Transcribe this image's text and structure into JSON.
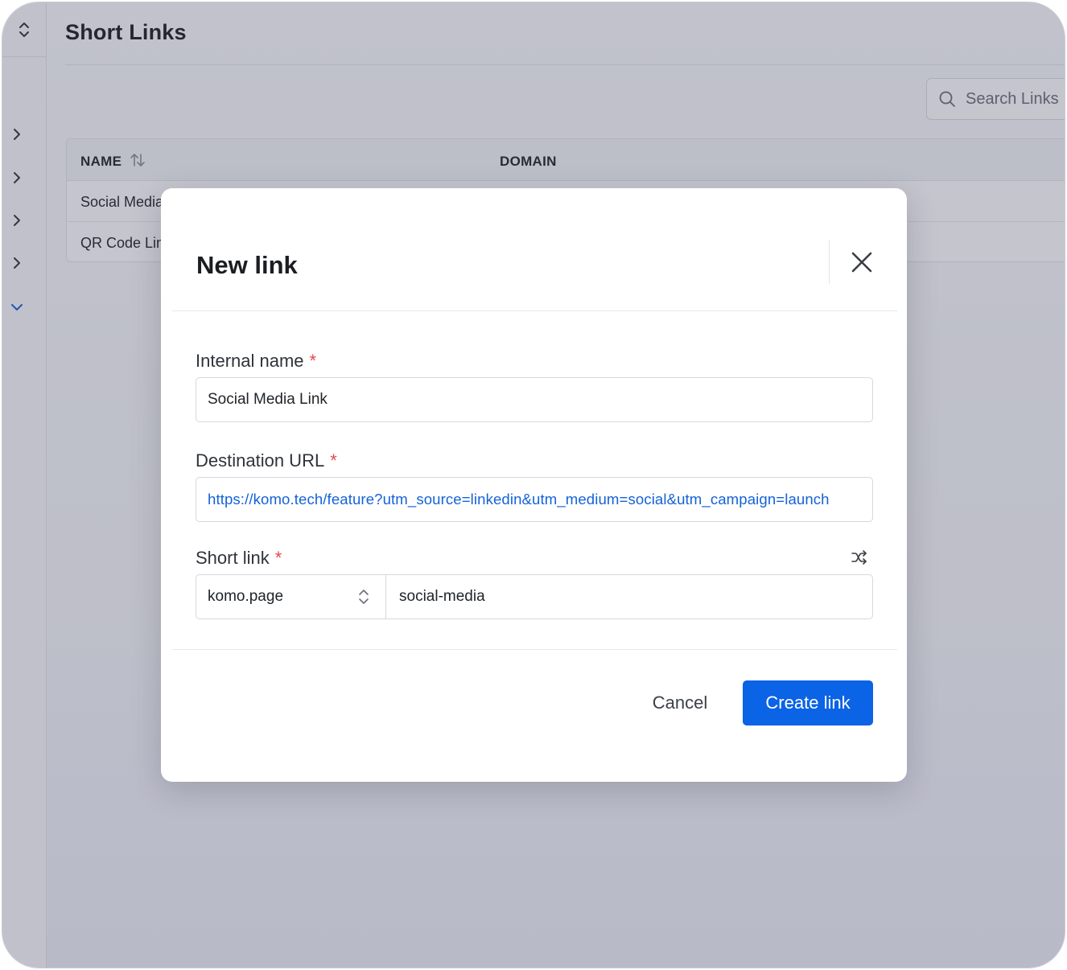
{
  "page": {
    "title": "Short Links"
  },
  "search": {
    "placeholder": "Search Links"
  },
  "table": {
    "columns": [
      "NAME",
      "DOMAIN"
    ],
    "rows": [
      {
        "name": "Social Media Link"
      },
      {
        "name": "QR Code Link"
      }
    ]
  },
  "modal": {
    "title": "New link",
    "fields": {
      "internal_name": {
        "label": "Internal name",
        "required": "*",
        "value": "Social Media Link"
      },
      "destination_url": {
        "label": "Destination URL",
        "required": "*",
        "value": "https://komo.tech/feature?utm_source=linkedin&utm_medium=social&utm_campaign=launch"
      },
      "short_link": {
        "label": "Short link",
        "required": "*",
        "domain": "komo.page",
        "slug": "social-media"
      }
    },
    "buttons": {
      "cancel": "Cancel",
      "create": "Create link"
    }
  },
  "colors": {
    "primary": "#0b63e5",
    "required": "#e5484d",
    "link": "#1463d8"
  }
}
